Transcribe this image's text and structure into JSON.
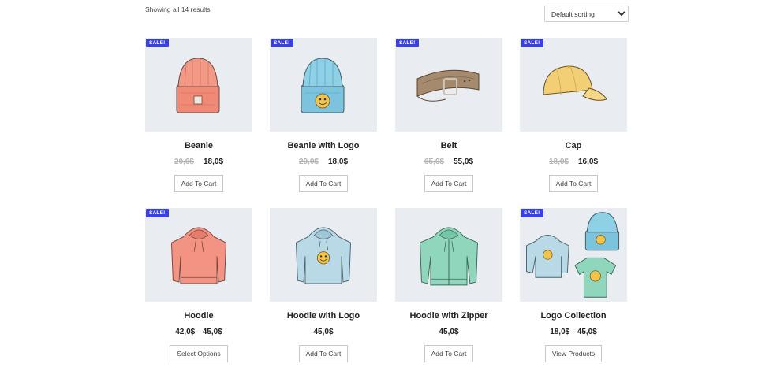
{
  "results_count": "Showing all 14 results",
  "sorting": {
    "selected": "Default sorting"
  },
  "sale_badge": "SALE!",
  "colors": {
    "sale_badge": "#3a3fe0",
    "thumb_bg": "#e9edf1"
  },
  "products": [
    {
      "title": "Beanie",
      "old_price": "20,0$",
      "price": "18,0$",
      "button": "Add To Cart",
      "icon": "beanie-icon"
    },
    {
      "title": "Beanie with Logo",
      "old_price": "20,0$",
      "price": "18,0$",
      "button": "Add To Cart",
      "icon": "beanie-logo-icon"
    },
    {
      "title": "Belt",
      "old_price": "65,0$",
      "price": "55,0$",
      "button": "Add To Cart",
      "icon": "belt-icon"
    },
    {
      "title": "Cap",
      "old_price": "18,0$",
      "price": "16,0$",
      "button": "Add To Cart",
      "icon": "cap-icon"
    },
    {
      "title": "Hoodie",
      "price_min": "42,0$",
      "price_max": "45,0$",
      "button": "Select Options",
      "icon": "hoodie-icon"
    },
    {
      "title": "Hoodie with Logo",
      "price": "45,0$",
      "button": "Add To Cart",
      "icon": "hoodie-logo-icon"
    },
    {
      "title": "Hoodie with Zipper",
      "price": "45,0$",
      "button": "Add To Cart",
      "icon": "hoodie-zipper-icon"
    },
    {
      "title": "Logo Collection",
      "price_min": "18,0$",
      "price_max": "45,0$",
      "button": "View Products",
      "icon": "logo-collection-icon"
    }
  ]
}
